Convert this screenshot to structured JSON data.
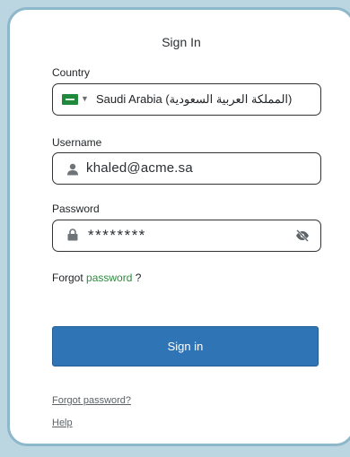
{
  "header": {
    "title": "Sign In"
  },
  "country": {
    "label": "Country",
    "value": "Saudi Arabia (المملكة العربية السعودية)",
    "flag_icon": "flag-saudi-arabia-icon",
    "colors": {
      "flag": "#1f8a3b"
    }
  },
  "username": {
    "label": "Username",
    "value": "khaled@acme.sa",
    "icon": "user-icon"
  },
  "password": {
    "label": "Password",
    "value": "********",
    "icon": "lock-icon",
    "toggle_icon": "eye-off-icon"
  },
  "forgot_inline": {
    "prefix": "Forgot",
    "link": "password",
    "suffix": "?"
  },
  "actions": {
    "signin_label": "Sign in",
    "colors": {
      "primary": "#2f74b5"
    }
  },
  "links": {
    "forgot_password": "Forgot password?",
    "help": "Help"
  }
}
